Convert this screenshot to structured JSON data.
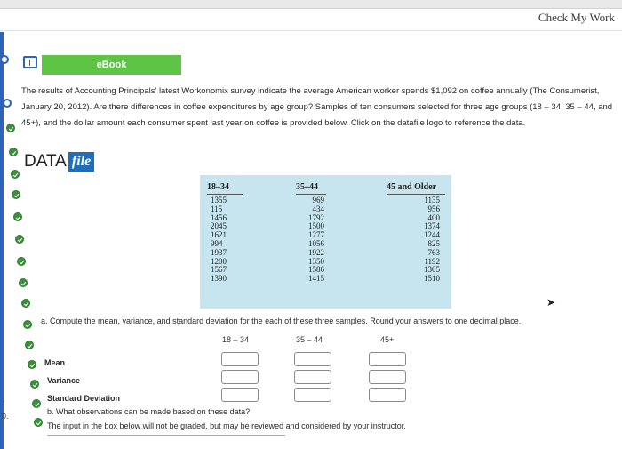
{
  "header": {
    "check_work": "Check My Work"
  },
  "left_rail": {
    "marks": [
      "-",
      "0."
    ]
  },
  "ebook": {
    "label": "eBook"
  },
  "intro": {
    "text": "The results of Accounting Principals' latest Workonomix survey indicate the average American worker spends $1,092 on coffee annually (The Consumerist, January 20, 2012). Are there differences in coffee expenditures by age group? Samples of ten consumers selected for three age groups (18 – 34, 35 – 44, and 45+), and the dollar amount each consumer spent last year on coffee is provided below. Click on the datafile logo to reference the data."
  },
  "datafile": {
    "data_word": "DATA",
    "file_word": "file"
  },
  "table": {
    "headers": [
      "18–34",
      "35–44",
      "45 and Older"
    ],
    "col_18_34": [
      "1355",
      "115",
      "1456",
      "2045",
      "1621",
      "994",
      "1937",
      "1200",
      "1567",
      "1390"
    ],
    "col_35_44": [
      "969",
      "434",
      "1792",
      "1500",
      "1277",
      "1056",
      "1922",
      "1350",
      "1586",
      "1415"
    ],
    "col_45_older": [
      "1135",
      "956",
      "400",
      "1374",
      "1244",
      "825",
      "763",
      "1192",
      "1305",
      "1510"
    ]
  },
  "question_a": {
    "text": "a. Compute the mean, variance, and standard deviation for the each of these three samples. Round your answers to one decimal place.",
    "col_heads": [
      "18 – 34",
      "35 – 44",
      "45+"
    ],
    "rows": [
      "Mean",
      "Variance",
      "Standard Deviation"
    ]
  },
  "question_b": {
    "text": "b. What observations can be made based on these data?",
    "note": "The input in the box below will not be graded, but may be reviewed and considered by your instructor."
  },
  "colors": {
    "ebook_green": "#5ec445",
    "file_blue": "#1f6fb8",
    "table_bg": "#c6e5ef",
    "status_green": "#3c8f3c",
    "rail_blue": "#2d63b8"
  }
}
